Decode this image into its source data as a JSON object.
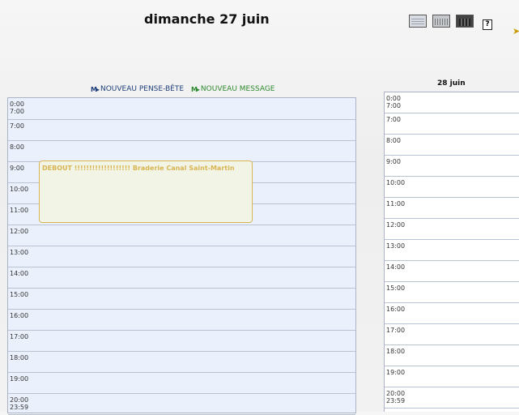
{
  "header": {
    "title": "dimanche 27 juin",
    "help_label": "?",
    "arrow_icon": "arrow-right-icon"
  },
  "actions": {
    "new_note": "NOUVEAU PENSE-BÊTE",
    "new_message": "NOUVEAU MESSAGE",
    "icon_glyph": "M▸"
  },
  "main_day": {
    "slots": [
      "0:00\n7:00",
      "7:00",
      "8:00",
      "9:00",
      "10:00",
      "11:00",
      "12:00",
      "13:00",
      "14:00",
      "15:00",
      "16:00",
      "17:00",
      "18:00",
      "19:00",
      "20:00\n23:59"
    ]
  },
  "event": {
    "text": "DEBOUT !!!!!!!!!!!!!!!!!!! Braderie Canal Saint-Martin",
    "start": "9:00",
    "end": "12:00"
  },
  "next_day": {
    "date": "28 juin",
    "slots": [
      "0:00\n7:00",
      "7:00",
      "8:00",
      "9:00",
      "10:00",
      "11:00",
      "12:00",
      "13:00",
      "14:00",
      "15:00",
      "16:00",
      "17:00",
      "18:00",
      "19:00",
      "20:00\n23:59"
    ]
  },
  "colors": {
    "accent_event": "#d8b453",
    "day_bg": "#eaf0fc",
    "note_blue": "#1f3f7a",
    "message_green": "#2f8a2f"
  }
}
